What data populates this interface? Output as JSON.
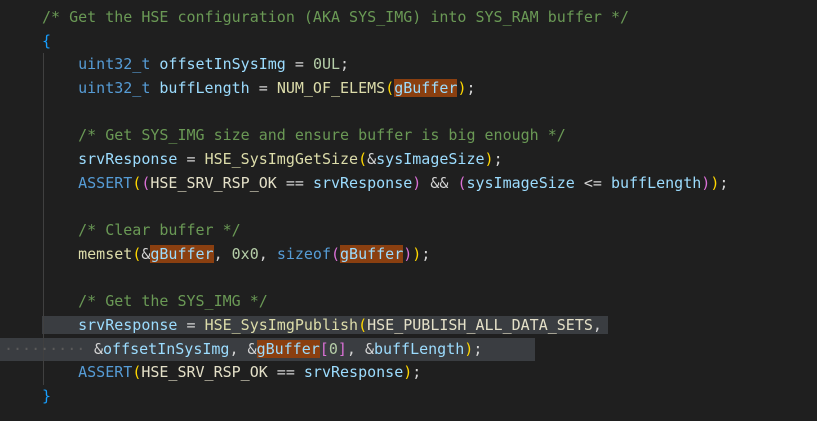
{
  "colors": {
    "background": "#1f1f1f",
    "selection": "#3a3d41",
    "highlight": "#8a3f10"
  },
  "lines": [
    {
      "indent": 0,
      "tokens": [
        [
          "/* Get the HSE configuration (AKA SYS_IMG) into SYS_RAM buffer */",
          "comment"
        ]
      ]
    },
    {
      "indent": 0,
      "tokens": [
        [
          "{",
          "b3"
        ]
      ]
    },
    {
      "indent": 1,
      "tokens": [
        [
          "uint32_t",
          "type"
        ],
        [
          " ",
          "op"
        ],
        [
          "offsetInSysImg",
          "var"
        ],
        [
          " = ",
          "op"
        ],
        [
          "0UL",
          "num"
        ],
        [
          ";",
          "op"
        ]
      ]
    },
    {
      "indent": 1,
      "tokens": [
        [
          "uint32_t",
          "type"
        ],
        [
          " ",
          "op"
        ],
        [
          "buffLength",
          "var"
        ],
        [
          " = ",
          "op"
        ],
        [
          "NUM_OF_ELEMS",
          "func"
        ],
        [
          "(",
          "b1"
        ],
        [
          "gBuffer",
          "hl"
        ],
        [
          ")",
          "b1"
        ],
        [
          ";",
          "op"
        ]
      ]
    },
    {
      "indent": 0,
      "tokens": []
    },
    {
      "indent": 1,
      "tokens": [
        [
          "/* Get SYS_IMG size and ensure buffer is big enough */",
          "comment"
        ]
      ]
    },
    {
      "indent": 1,
      "tokens": [
        [
          "srvResponse",
          "var"
        ],
        [
          " = ",
          "op"
        ],
        [
          "HSE_SysImgGetSize",
          "func"
        ],
        [
          "(",
          "b1"
        ],
        [
          "&",
          "op"
        ],
        [
          "sysImageSize",
          "var"
        ],
        [
          ")",
          "b1"
        ],
        [
          ";",
          "op"
        ]
      ]
    },
    {
      "indent": 1,
      "tokens": [
        [
          "ASSERT",
          "macro"
        ],
        [
          "(",
          "b1"
        ],
        [
          "(",
          "b2"
        ],
        [
          "HSE_SRV_RSP_OK",
          "const"
        ],
        [
          " == ",
          "op"
        ],
        [
          "srvResponse",
          "var"
        ],
        [
          ")",
          "b2"
        ],
        [
          " && ",
          "op"
        ],
        [
          "(",
          "b2"
        ],
        [
          "sysImageSize",
          "var"
        ],
        [
          " <= ",
          "op"
        ],
        [
          "buffLength",
          "var"
        ],
        [
          ")",
          "b2"
        ],
        [
          ")",
          "b1"
        ],
        [
          ";",
          "op"
        ]
      ]
    },
    {
      "indent": 0,
      "tokens": []
    },
    {
      "indent": 1,
      "tokens": [
        [
          "/* Clear buffer */",
          "comment"
        ]
      ]
    },
    {
      "indent": 1,
      "tokens": [
        [
          "memset",
          "func"
        ],
        [
          "(",
          "b1"
        ],
        [
          "&",
          "op"
        ],
        [
          "gBuffer",
          "hl"
        ],
        [
          ", ",
          "op"
        ],
        [
          "0x0",
          "num"
        ],
        [
          ", ",
          "op"
        ],
        [
          "sizeof",
          "type"
        ],
        [
          "(",
          "b2"
        ],
        [
          "gBuffer",
          "hl"
        ],
        [
          ")",
          "b2"
        ],
        [
          ")",
          "b1"
        ],
        [
          ";",
          "op"
        ]
      ]
    },
    {
      "indent": 0,
      "tokens": []
    },
    {
      "indent": 1,
      "tokens": [
        [
          "/* Get the SYS_IMG */",
          "comment"
        ]
      ]
    },
    {
      "indent": 1,
      "selected": true,
      "tokens": [
        [
          "srvResponse",
          "var"
        ],
        [
          " = ",
          "op"
        ],
        [
          "HSE_SysImgPublish",
          "func"
        ],
        [
          "(",
          "b1"
        ],
        [
          "HSE_PUBLISH_ALL_DATA_SETS",
          "const"
        ],
        [
          ",",
          "op"
        ]
      ]
    },
    {
      "indent": 1,
      "selected": true,
      "wrap": true,
      "tokens": [
        [
          "&",
          "op"
        ],
        [
          "offsetInSysImg",
          "var"
        ],
        [
          ", ",
          "op"
        ],
        [
          "&",
          "op"
        ],
        [
          "gBuffer",
          "hl"
        ],
        [
          "[",
          "b2"
        ],
        [
          "0",
          "num"
        ],
        [
          "]",
          "b2"
        ],
        [
          ", ",
          "op"
        ],
        [
          "&",
          "op"
        ],
        [
          "buffLength",
          "var"
        ],
        [
          ")",
          "b1"
        ],
        [
          ";",
          "op"
        ]
      ]
    },
    {
      "indent": 1,
      "tokens": [
        [
          "ASSERT",
          "macro"
        ],
        [
          "(",
          "b1"
        ],
        [
          "HSE_SRV_RSP_OK",
          "const"
        ],
        [
          " == ",
          "op"
        ],
        [
          "srvResponse",
          "var"
        ],
        [
          ")",
          "b1"
        ],
        [
          ";",
          "op"
        ]
      ]
    },
    {
      "indent": 0,
      "tokens": [
        [
          "}",
          "b3"
        ]
      ]
    }
  ]
}
